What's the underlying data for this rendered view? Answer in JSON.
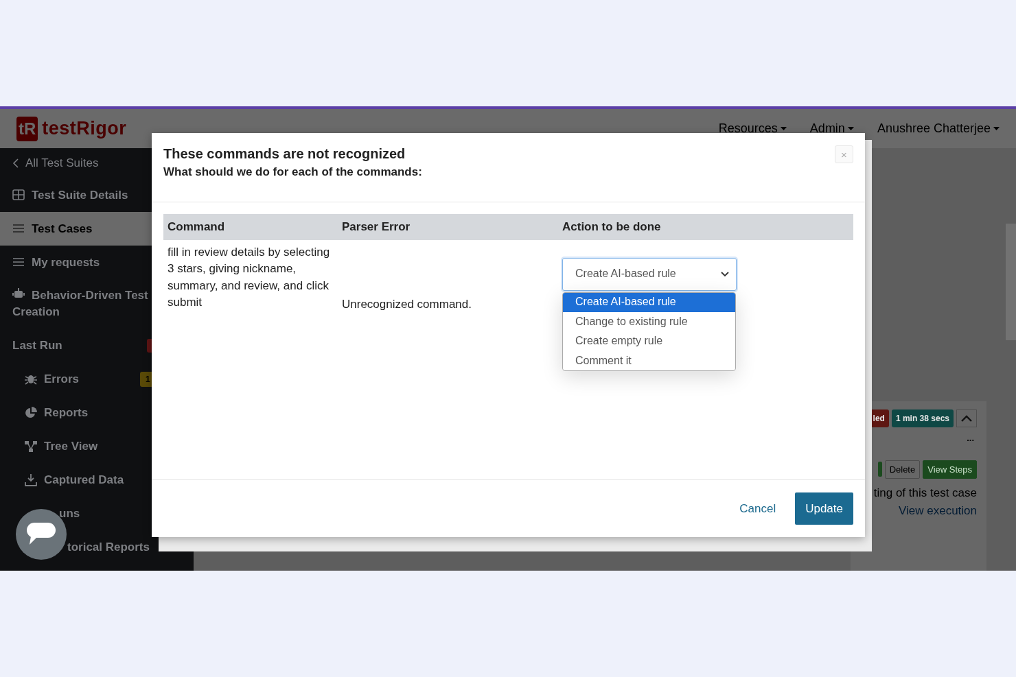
{
  "header": {
    "logo_mark": "tR",
    "logo_text": "testRigor",
    "nav": [
      {
        "label": "Resources",
        "caret": true
      },
      {
        "label": "Admin",
        "caret": true
      },
      {
        "label": "Anushree Chatterjee",
        "caret": true
      }
    ]
  },
  "sidebar": {
    "items": [
      {
        "kind": "back",
        "label": "All Test Suites",
        "selected": false
      },
      {
        "kind": "item",
        "label": "Test Suite Details",
        "selected": false
      },
      {
        "kind": "item",
        "label": "Test Cases",
        "selected": true
      },
      {
        "kind": "item",
        "label": "My requests",
        "selected": false
      },
      {
        "kind": "item",
        "label": "Behavior-Driven Test Creation",
        "selected": false
      },
      {
        "kind": "heading",
        "label": "Last Run",
        "badge": {
          "color": "#5e1414"
        }
      },
      {
        "kind": "subitem",
        "label": "Errors",
        "selected": false,
        "badge": {
          "text": "1",
          "color": "#5a4a08"
        }
      },
      {
        "kind": "subitem",
        "label": "Reports",
        "selected": false
      },
      {
        "kind": "subitem",
        "label": "Tree View",
        "selected": false
      },
      {
        "kind": "subitem",
        "label": "Captured Data",
        "selected": false
      },
      {
        "kind": "covered",
        "label": "uns",
        "selected": false
      },
      {
        "kind": "covered",
        "label": "torical Reports",
        "selected": false
      }
    ]
  },
  "background_panel": {
    "badges": [
      {
        "text": "led",
        "color": "#5e1712"
      },
      {
        "text": "1 min 38 secs",
        "color": "#0f4845"
      }
    ],
    "more": "...",
    "buttons": [
      {
        "label": "Delete",
        "kind": "outline"
      },
      {
        "label": "View Steps",
        "kind": "success"
      }
    ],
    "description": "ting of this test case",
    "link": "View execution"
  },
  "modal": {
    "title": "These commands are not recognized",
    "subtitle": "What should we do for each of the commands:",
    "close": "×",
    "table": {
      "columns": [
        "Command",
        "Parser Error",
        "Action to be done"
      ],
      "rows": [
        {
          "command": "fill in review details by selecting 3 stars, giving nickname, summary, and review, and click submit",
          "parser_error": "Unrecognized command.",
          "action": {
            "value": "Create AI-based rule",
            "expanded": true,
            "options": [
              {
                "label": "Create AI-based rule",
                "selected": true
              },
              {
                "label": "Change to existing rule",
                "selected": false
              },
              {
                "label": "Create empty rule",
                "selected": false
              },
              {
                "label": "Comment it",
                "selected": false
              }
            ]
          }
        }
      ]
    },
    "buttons": [
      {
        "label": "Cancel",
        "kind": "link"
      },
      {
        "label": "Update",
        "kind": "primary"
      }
    ]
  }
}
